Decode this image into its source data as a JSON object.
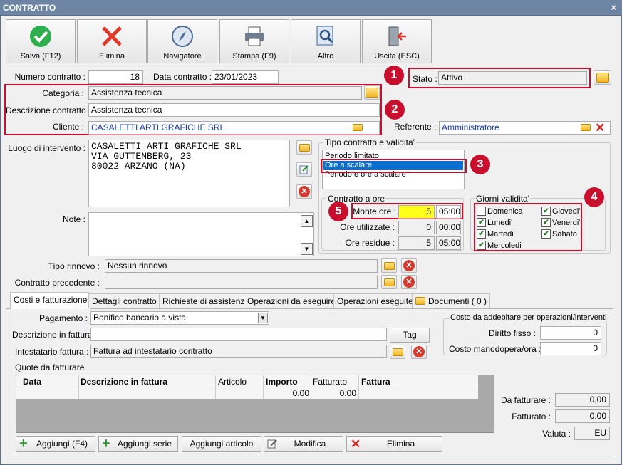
{
  "window": {
    "title": "CONTRATTO",
    "close": "×"
  },
  "toolbar": {
    "save": "Salva (F12)",
    "delete": "Elimina",
    "navigator": "Navigatore",
    "print": "Stampa (F9)",
    "other": "Altro",
    "exit": "Uscita (ESC)"
  },
  "header": {
    "numero_label": "Numero contratto :",
    "numero": "18",
    "data_label": "Data contratto :",
    "data": "23/01/2023",
    "stato_label": "Stato :",
    "stato": "Attivo",
    "categoria_label": "Categoria :",
    "categoria": "Assistenza tecnica",
    "descrizione_label": "Descrizione contratto :",
    "descrizione": "Assistenza tecnica",
    "cliente_label": "Cliente :",
    "cliente": "CASALETTI ARTI GRAFICHE SRL",
    "referente_label": "Referente :",
    "referente": "Amministratore",
    "luogo_label": "Luogo di intervento :",
    "luogo_lines": [
      "CASALETTI ARTI GRAFICHE SRL",
      "VIA GUTTENBERG, 23",
      "80022 ARZANO (NA)"
    ],
    "note_label": "Note :",
    "tipo_rinnovo_label": "Tipo rinnovo :",
    "tipo_rinnovo": "Nessun rinnovo",
    "contratto_prec_label": "Contratto precedente :",
    "contratto_prec": ""
  },
  "tipo_contratto": {
    "title": "Tipo contratto e validita'",
    "options": [
      "Periodo limitato",
      "Ore a scalare",
      "Periodo e ore a scalare"
    ],
    "selected": "Ore a scalare"
  },
  "contratto_ore": {
    "title": "Contratto a ore",
    "monte_label": "Monte ore :",
    "monte": "5",
    "monte_time": "05:00",
    "utilizzate_label": "Ore utilizzate :",
    "utilizzate": "0",
    "utilizzate_time": "00:00",
    "residue_label": "Ore residue :",
    "residue": "5",
    "residue_time": "05:00"
  },
  "giorni": {
    "title": "Giorni validita'",
    "days": [
      {
        "label": "Domenica",
        "checked": false
      },
      {
        "label": "Lunedi'",
        "checked": true
      },
      {
        "label": "Martedi'",
        "checked": true
      },
      {
        "label": "Mercoledi'",
        "checked": true
      },
      {
        "label": "Giovedi'",
        "checked": true
      },
      {
        "label": "Venerdi'",
        "checked": true
      },
      {
        "label": "Sabato",
        "checked": true
      }
    ]
  },
  "badges": [
    "1",
    "2",
    "3",
    "4",
    "5"
  ],
  "tabs": [
    "Costi e fatturazione",
    "Dettagli contratto",
    "Richieste di assistenza",
    "Operazioni da eseguire",
    "Operazioni eseguite",
    "Documenti ( 0 )"
  ],
  "costi": {
    "pagamento_label": "Pagamento :",
    "pagamento": "Bonifico bancario a vista",
    "descr_fatt_label": "Descrizione in fattura",
    "descr_fatt": "",
    "tag": "Tag",
    "intestatario_label": "Intestatario fattura :",
    "intestatario": "Fattura ad intestatario contratto",
    "quote_label": "Quote da fatturare",
    "table": {
      "headers": [
        "Data",
        "Descrizione in fattura",
        "Articolo",
        "Importo",
        "Fatturato",
        "Fattura"
      ],
      "row": [
        "",
        "",
        "",
        "0,00",
        "0,00",
        ""
      ]
    },
    "addebito": {
      "title": "Costo da addebitare per operazioni/interventi",
      "diritto_label": "Diritto fisso :",
      "diritto": "0",
      "manodopera_label": "Costo manodopera/ora :",
      "manodopera": "0"
    },
    "totali": {
      "da_fatturare_label": "Da fatturare :",
      "da_fatturare": "0,00",
      "fatturato_label": "Fatturato :",
      "fatturato": "0,00",
      "valuta_label": "Valuta :",
      "valuta": "EU"
    },
    "buttons": {
      "aggiungi": "Aggiungi (F4)",
      "serie": "Aggiungi serie",
      "articolo": "Aggiungi articolo",
      "modifica": "Modifica",
      "elimina": "Elimina"
    }
  }
}
